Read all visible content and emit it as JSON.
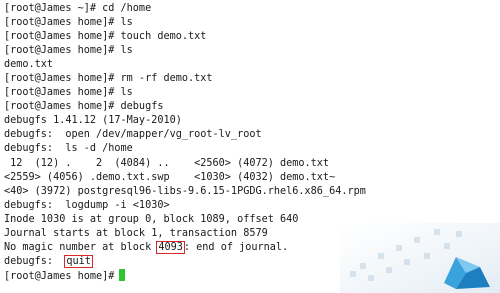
{
  "terminal": {
    "lines": [
      "[root@James ~]# cd /home",
      "[root@James home]# ls",
      "[root@James home]# touch demo.txt",
      "[root@James home]# ls",
      "demo.txt",
      "[root@James home]# rm -rf demo.txt",
      "[root@James home]# ls",
      "[root@James home]# debugfs",
      "debugfs 1.41.12 (17-May-2010)",
      "debugfs:  open /dev/mapper/vg_root-lv_root",
      "debugfs:  ls -d /home",
      " 12  (12) .    2  (4084) ..    <2560> (4072) demo.txt",
      "<2559> (4056) .demo.txt.swp    <1030> (4032) demo.txt~",
      "<40> (3972) postgresql96-libs-9.6.15-1PGDG.rhel6.x86_64.rpm",
      "debugfs:  logdump -i <1030>",
      "Inode 1030 is at group 0, block 1089, offset 640",
      "Journal starts at block 1, transaction 8579"
    ],
    "magic_line": {
      "prefix": "No magic number at block ",
      "block": "4093",
      "suffix": ": end of journal."
    },
    "quit_line": {
      "prompt": "debugfs:  ",
      "command": "quit"
    },
    "final_prompt": "[root@James home]#"
  },
  "colors": {
    "text": "#1a1a1a",
    "highlight_box": "#d9282a",
    "cursor": "#2ec52e"
  }
}
